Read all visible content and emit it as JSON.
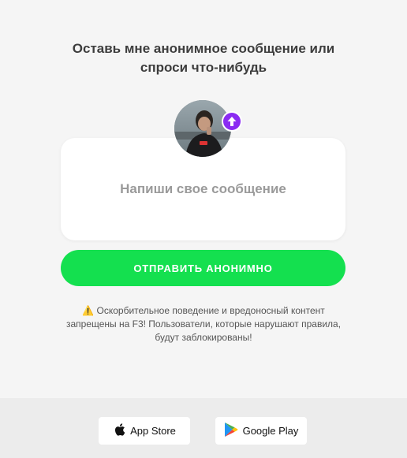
{
  "heading": "Оставь мне анонимное сообщение или спроси что-нибудь",
  "message": {
    "placeholder": "Напиши свое сообщение",
    "value": ""
  },
  "send_button_label": "ОТПРАВИТЬ АНОНИМНО",
  "warning": {
    "icon": "warning-icon",
    "text": "Оскорбительное поведение и вредоносный контент запрещены на F3! Пользователи, которые нарушают правила, будут заблокированы!"
  },
  "footer": {
    "app_store_label": "App Store",
    "google_play_label": "Google Play"
  },
  "colors": {
    "accent_green": "#14e04f",
    "badge_purple": "#8a2bf2",
    "background": "#f5f5f5",
    "footer_background": "#ececec"
  }
}
